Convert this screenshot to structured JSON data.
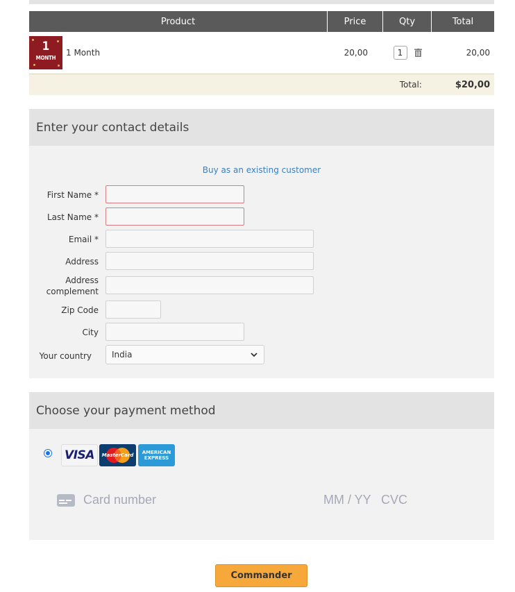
{
  "cart": {
    "headers": {
      "product": "Product",
      "price": "Price",
      "qty": "Qty",
      "total": "Total"
    },
    "items": [
      {
        "thumb_number": "1",
        "thumb_word": "MONTH",
        "name": "1 Month",
        "price": "20,00",
        "qty": "1",
        "total": "20,00"
      }
    ],
    "total_label": "Total:",
    "total_value": "$20,00"
  },
  "contact": {
    "title": "Enter your contact details",
    "existing_link": "Buy as an existing customer",
    "fields": {
      "first_name": {
        "label": "First Name *",
        "value": ""
      },
      "last_name": {
        "label": "Last Name *",
        "value": ""
      },
      "email": {
        "label": "Email *",
        "value": ""
      },
      "address": {
        "label": "Address",
        "value": ""
      },
      "address_complement": {
        "label": "Address complement",
        "value": ""
      },
      "zip": {
        "label": "Zip Code",
        "value": ""
      },
      "city": {
        "label": "City",
        "value": ""
      },
      "country": {
        "label": "Your country",
        "value": "India"
      }
    }
  },
  "payment": {
    "title": "Choose your payment method",
    "cards": {
      "visa": "VISA",
      "mastercard": "MasterCard",
      "amex": "AMERICAN EXPRESS"
    },
    "card_number_placeholder": "Card number",
    "expiry_placeholder": "MM / YY",
    "cvc_placeholder": "CVC"
  },
  "submit_label": "Commander",
  "colors": {
    "accent": "#f6a83b",
    "header_bg": "#5a5a5a",
    "link": "#3a7fc1"
  }
}
